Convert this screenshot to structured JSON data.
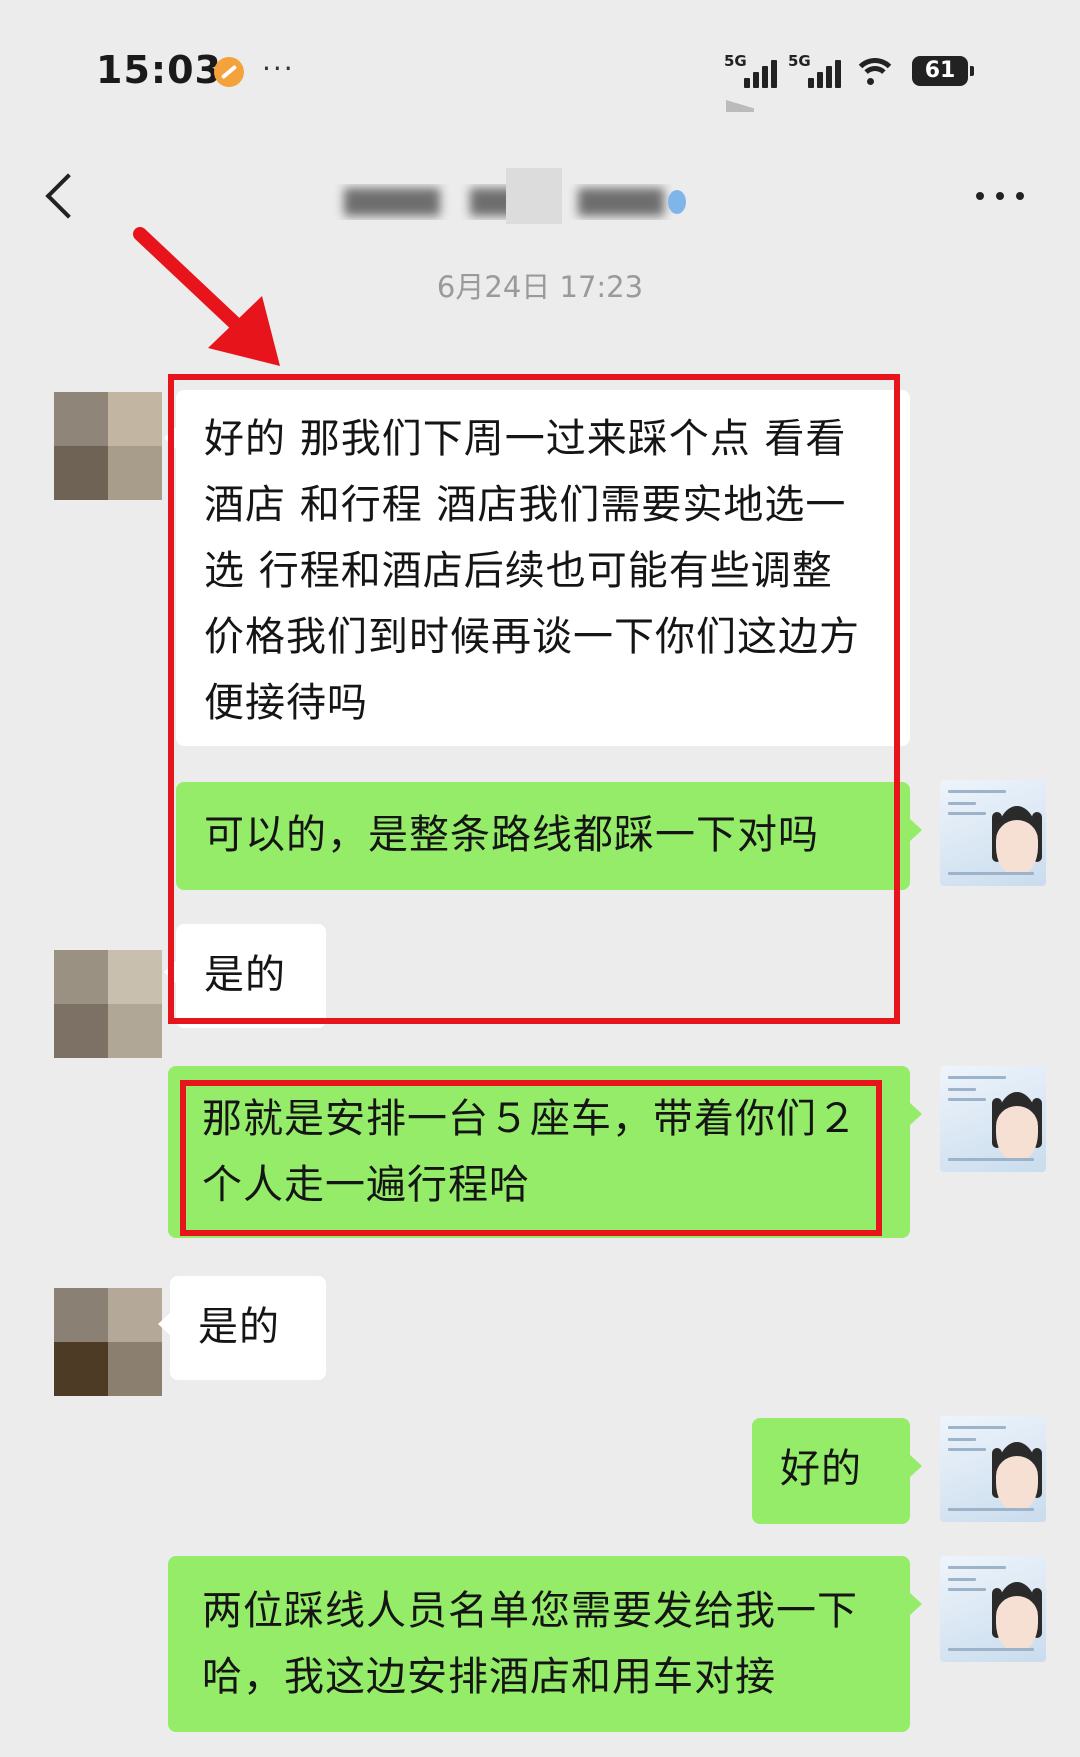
{
  "status_bar": {
    "time": "15:03",
    "signal_1": "5G",
    "signal_2": "5G",
    "battery": "61",
    "more_indicator": "···"
  },
  "nav": {
    "back_icon": "chevron-left-icon",
    "menu_icon": "more-horizontal-icon"
  },
  "chat": {
    "timestamp": "6月24日 17:23",
    "messages": [
      {
        "side": "in",
        "text": "好的 那我们下周一过来踩个点 看看酒店 和行程 酒店我们需要实地选一选 行程和酒店后续也可能有些调整 价格我们到时候再谈一下你们这边方便接待吗"
      },
      {
        "side": "out",
        "text": "可以的，是整条路线都踩一下对吗"
      },
      {
        "side": "in",
        "text": "是的"
      },
      {
        "side": "out",
        "text": "那就是安排一台５座车，带着你们２个人走一遍行程哈"
      },
      {
        "side": "in",
        "text": "是的"
      },
      {
        "side": "out",
        "text": "好的"
      },
      {
        "side": "out",
        "text": "两位踩线人员名单您需要发给我一下哈，我这边安排酒店和用车对接"
      }
    ]
  },
  "colors": {
    "background": "#ececec",
    "incoming_bubble": "#ffffff",
    "outgoing_bubble": "#95ec69",
    "annotation_red": "#e8141b"
  }
}
